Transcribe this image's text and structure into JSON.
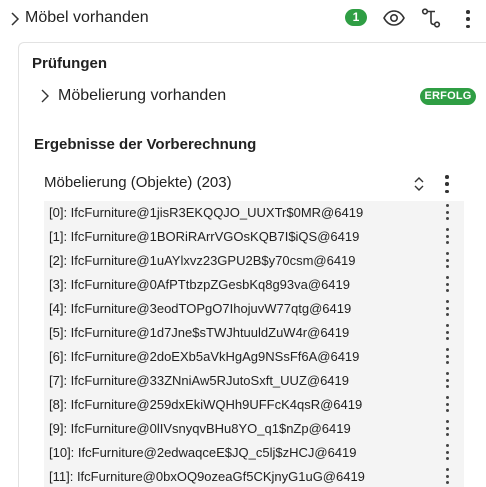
{
  "header": {
    "title": "Möbel vorhanden",
    "count": "1",
    "icons": [
      "chevron-right-icon",
      "eye-icon",
      "branch-icon",
      "more-vertical-icon"
    ]
  },
  "checks": {
    "title": "Prüfungen",
    "items": [
      {
        "label": "Möbelierung vorhanden",
        "status": "ERFOLG",
        "status_color": "#2f9e44"
      }
    ]
  },
  "results": {
    "title": "Ergebnisse der Vorberechnung",
    "list_title": "Möbelierung (Objekte) (203)",
    "items": [
      "[0]: IfcFurniture@1jisR3EKQQJO_UUXTr$0MR@6419",
      "[1]: IfcFurniture@1BORiRArrVGOsKQB7I$iQS@6419",
      "[2]: IfcFurniture@1uAYlxvz23GPU2B$y70csm@6419",
      "[3]: IfcFurniture@0AfPTtbzpZGesbKq8g93va@6419",
      "[4]: IfcFurniture@3eodTOPgO7IhojuvW77qtg@6419",
      "[5]: IfcFurniture@1d7Jne$sTWJhtuuldZuW4r@6419",
      "[6]: IfcFurniture@2doEXb5aVkHgAg9NSsFf6A@6419",
      "[7]: IfcFurniture@33ZNniAw5RJutoSxft_UUZ@6419",
      "[8]: IfcFurniture@259dxEkiWQHh9UFFcK4qsR@6419",
      "[9]: IfcFurniture@0lIVsnyqvBHu8YO_q1$nZp@6419",
      "[10]: IfcFurniture@2edwaqceE$JQ_c5lj$zHCJ@6419",
      "[11]: IfcFurniture@0bxOQ9ozeaGf5CKjnyG1uG@6419"
    ]
  },
  "colors": {
    "success": "#2f9e44",
    "list_bg": "#f4f4f4",
    "border": "#e2e2e2"
  }
}
